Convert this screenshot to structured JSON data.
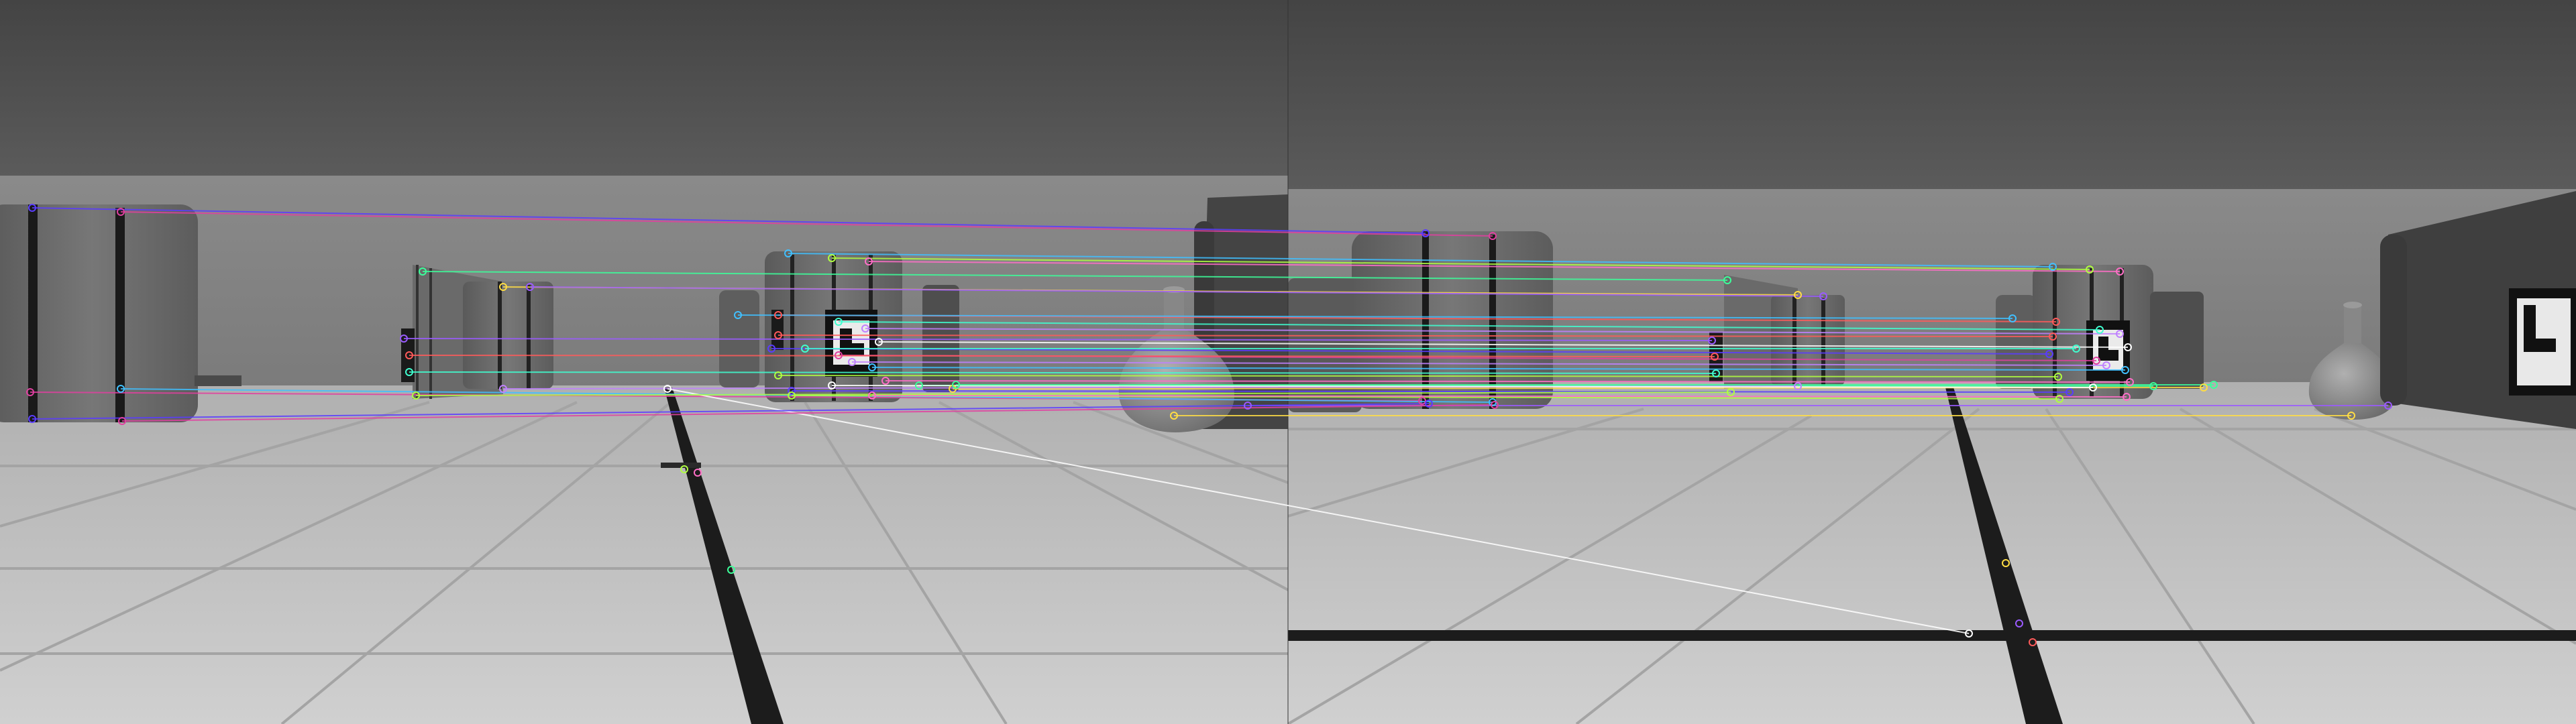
{
  "image": {
    "description_kind": "stereo feature matching visualization",
    "panels": [
      {
        "id": "left-view"
      },
      {
        "id": "right-view"
      }
    ]
  },
  "colors": {
    "sky_top": "#474747",
    "sky_bottom": "#5a5a5a",
    "wall": "#858585",
    "floor": "#c2c2c2",
    "floor_line": "#a6a6a6",
    "tape": "#1f1f1f",
    "box": "#666666",
    "box_dark": "#3c3c3c",
    "vase": "#8c8c8c",
    "match_palette": [
      "#5a3cff",
      "#e040a0",
      "#40c0ff",
      "#b0ff40",
      "#ff6ec7",
      "#3cff9a",
      "#ffdd44",
      "#9a5aff",
      "#ff5a5a",
      "#40ffd0",
      "#c080ff",
      "#ffffff"
    ]
  }
}
